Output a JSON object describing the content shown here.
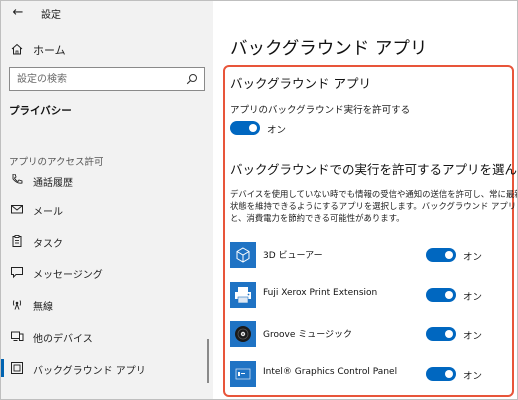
{
  "window": {
    "back_glyph": "←",
    "title": "設定"
  },
  "sidebar": {
    "home_label": "ホーム",
    "search_placeholder": "設定の検索",
    "privacy_heading": "プライバシー",
    "section_label": "アプリのアクセス許可",
    "items": [
      {
        "label": "通話履歴",
        "icon": "call-history-icon"
      },
      {
        "label": "メール",
        "icon": "mail-icon"
      },
      {
        "label": "タスク",
        "icon": "tasks-icon"
      },
      {
        "label": "メッセージング",
        "icon": "messaging-icon"
      },
      {
        "label": "無線",
        "icon": "radios-icon"
      },
      {
        "label": "他のデバイス",
        "icon": "other-devices-icon"
      },
      {
        "label": "バックグラウンド アプリ",
        "icon": "background-apps-icon",
        "selected": true
      }
    ]
  },
  "main": {
    "page_title": "バックグラウンド アプリ",
    "section_title": "バックグラウンド アプリ",
    "allow_label": "アプリのバックグラウンド実行を許可する",
    "allow_toggle": {
      "state": "on",
      "label": "オン"
    },
    "choose_title": "バックグラウンドでの実行を許可するアプリを選んでください",
    "description_lines": [
      "デバイスを使用していない時でも情報の受信や通知の送信を許可し、常に最新の",
      "状態を維持できるようにするアプリを選択します。バックグラウンド アプリをオフにする",
      "と、消費電力を節約できる可能性があります。"
    ],
    "apps": [
      {
        "name": "3D ビューアー",
        "icon": "3d-viewer-icon",
        "toggle_label": "オン",
        "state": "on"
      },
      {
        "name": "Fuji Xerox Print Extension",
        "icon": "print-extension-icon",
        "toggle_label": "オン",
        "state": "on"
      },
      {
        "name": "Groove ミュージック",
        "icon": "groove-music-icon",
        "toggle_label": "オン",
        "state": "on"
      },
      {
        "name": "Intel® Graphics Control Panel",
        "icon": "intel-graphics-icon",
        "toggle_label": "オン",
        "state": "on"
      }
    ]
  },
  "colors": {
    "accent": "#0067c0",
    "highlight_border": "#e8553a",
    "sidebar_bg": "#f2f2f2",
    "app_tile": "#1f73c4"
  }
}
